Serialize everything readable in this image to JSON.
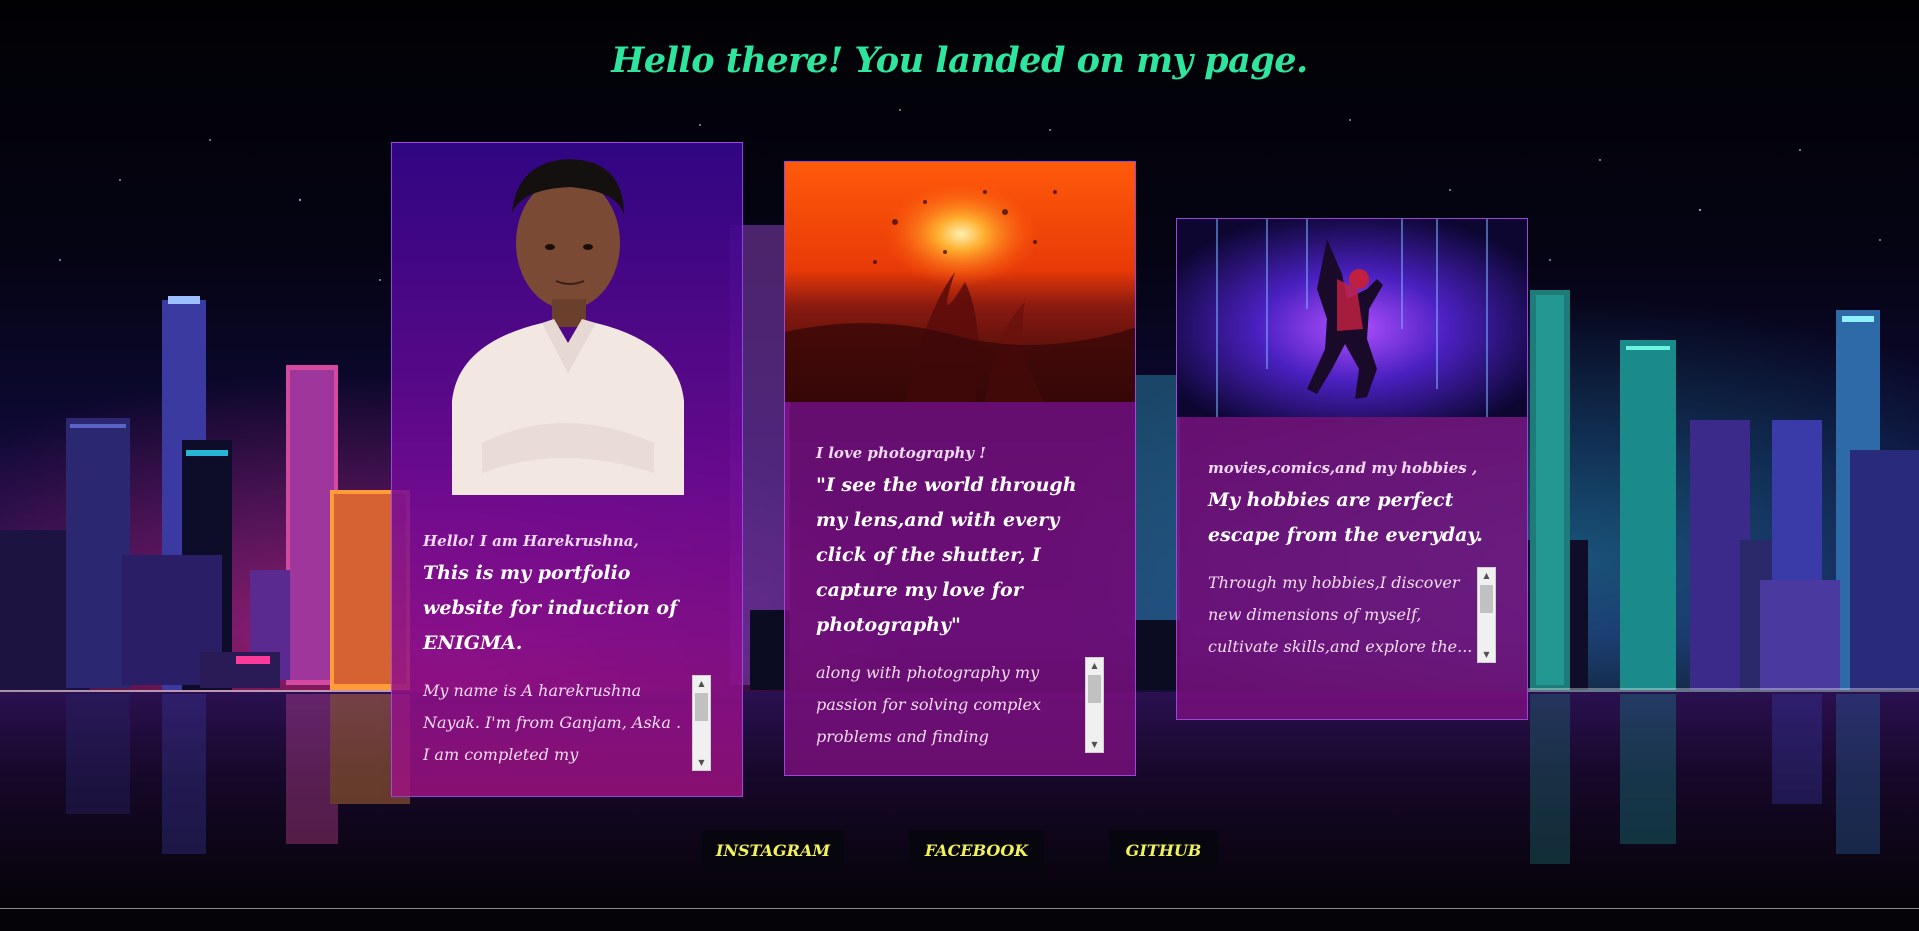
{
  "page": {
    "title": "Hello there! You landed on my page."
  },
  "cards": [
    {
      "image": "portrait-photo",
      "intro": "Hello! I am Harekrushna,",
      "headline": "This is my portfolio website for induction of ENIGMA.",
      "body": "My name is A harekrushna Nayak. I'm from Ganjam, Aska . I am completed my intermediate..."
    },
    {
      "image": "water-splash-sunset-photo",
      "intro": "I love photography !",
      "headline": "\"I see the world through my lens,and with every click of the shutter, I capture my love for photography\"",
      "body": "along with photography my passion for solving complex problems and finding innovative..."
    },
    {
      "image": "spider-man-neon-artwork",
      "intro": "movies,comics,and my hobbies ,",
      "headline": "My hobbies are perfect escape from the everyday.",
      "body": "Through my hobbies,I discover new dimensions of myself, cultivate skills,and explore the..."
    }
  ],
  "social": {
    "instagram": "INSTAGRAM",
    "facebook": "FACEBOOK",
    "github": "GITHUB"
  },
  "colors": {
    "title": "#2ee59d",
    "social_text": "#f2f25a",
    "card_bg": "#80108280"
  }
}
